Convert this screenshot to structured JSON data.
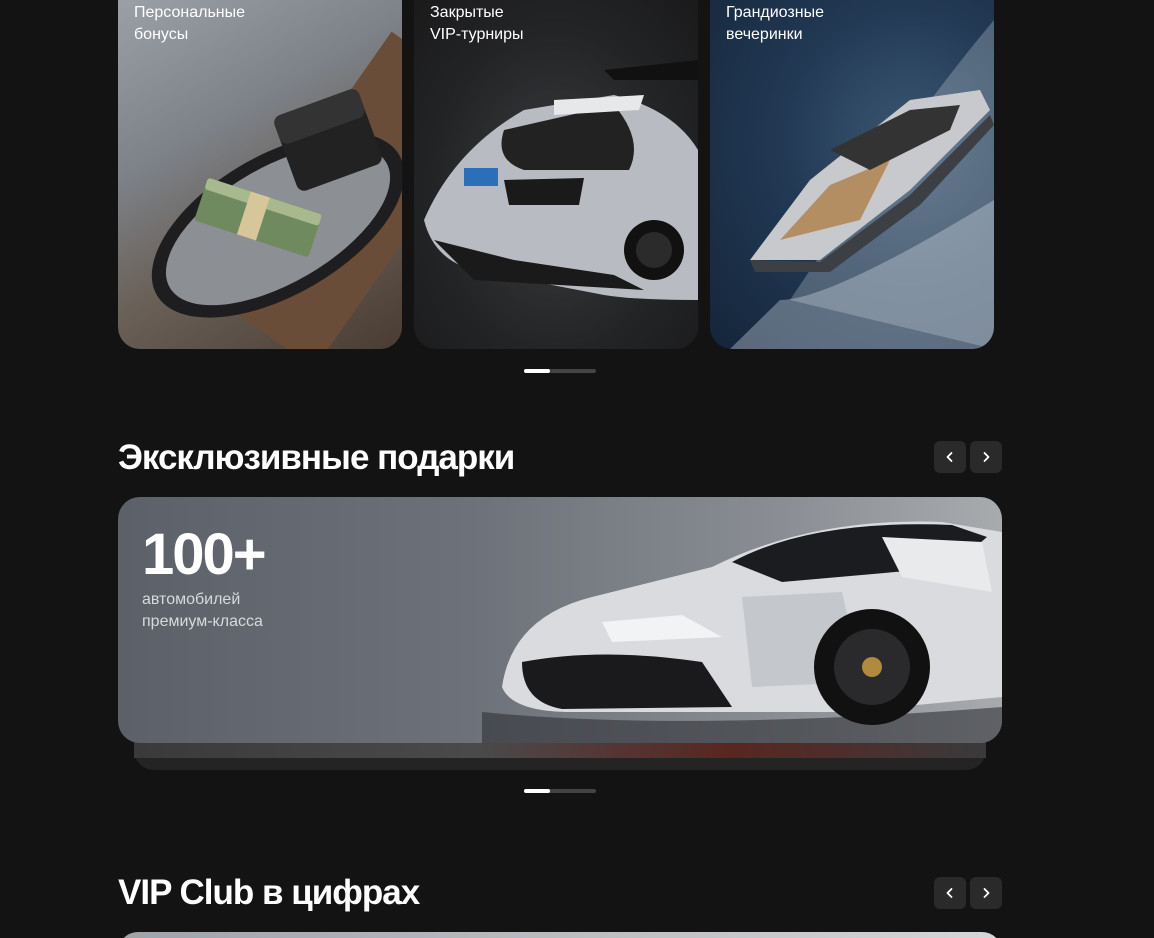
{
  "cards": [
    {
      "label": "Персональные\nбонусы"
    },
    {
      "label": "Закрытые\nVIP-турниры"
    },
    {
      "label": "Грандиозные\nвечеринки"
    }
  ],
  "sections": {
    "gifts": {
      "title": "Эксклюзивные подарки",
      "banner_number": "100+",
      "banner_caption": "автомобилей\nпремиум-класса"
    },
    "stats": {
      "title": "VIP Club в цифрах"
    }
  },
  "icons": {
    "prev": "chevron-left-icon",
    "next": "chevron-right-icon"
  },
  "carousels": {
    "cards_page": 1,
    "gifts_page": 1
  }
}
